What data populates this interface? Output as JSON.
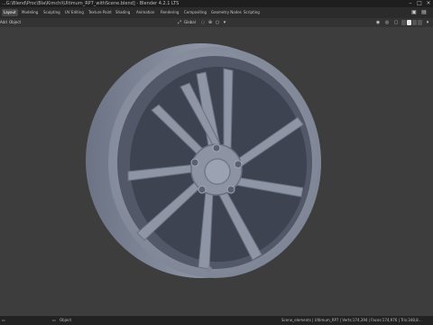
{
  "window": {
    "title": "...G:\\Blend\\Proc\\Bla\\Kimchi\\Ultimum_RP7_withScene.blend] - Blender 4.2.1 LTS"
  },
  "workspaces": [
    {
      "label": "Layout",
      "active": true
    },
    {
      "label": "Modeling",
      "active": false
    },
    {
      "label": "Sculpting",
      "active": false
    },
    {
      "label": "UV Editing",
      "active": false
    },
    {
      "label": "Texture Paint",
      "active": false
    },
    {
      "label": "Shading",
      "active": false
    },
    {
      "label": "Animation",
      "active": false
    },
    {
      "label": "Rendering",
      "active": false
    },
    {
      "label": "Compositing",
      "active": false
    },
    {
      "label": "Geometry Nodes",
      "active": false
    },
    {
      "label": "Scripting",
      "active": false
    }
  ],
  "viewport_header": {
    "menu_add": "Add",
    "menu_object": "Object",
    "transform_orientation": "Global"
  },
  "viewport": {
    "shading_mode": "solid",
    "background_color": "#3d3d3d",
    "object_color": "#8c93a3"
  },
  "statusbar": {
    "left_label": "Object",
    "scene_stats": "Scene_elements | Ultimum_RP7 | Verts:174,394 | Faces:174,976 | Tris:348,8..."
  }
}
